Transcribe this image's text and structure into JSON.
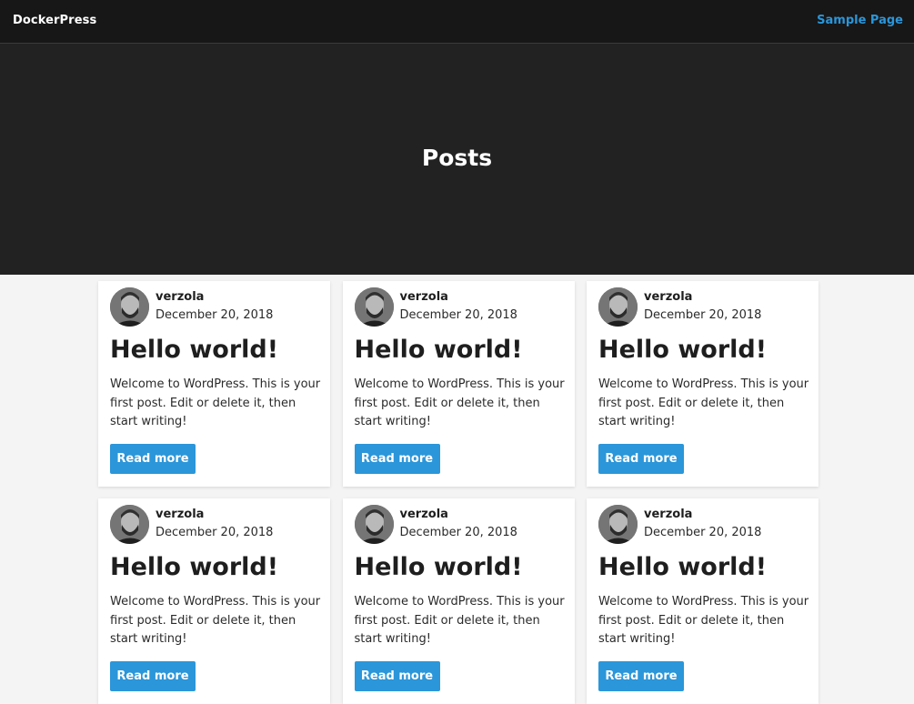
{
  "header": {
    "site_title": "DockerPress",
    "nav_link": "Sample Page"
  },
  "hero": {
    "title": "Posts"
  },
  "posts": [
    {
      "author": "verzola",
      "date": "December 20, 2018",
      "title": "Hello world!",
      "excerpt": "Welcome to WordPress. This is your first post. Edit or delete it, then start writing!",
      "button": "Read more"
    },
    {
      "author": "verzola",
      "date": "December 20, 2018",
      "title": "Hello world!",
      "excerpt": "Welcome to WordPress. This is your first post. Edit or delete it, then start writing!",
      "button": "Read more"
    },
    {
      "author": "verzola",
      "date": "December 20, 2018",
      "title": "Hello world!",
      "excerpt": "Welcome to WordPress. This is your first post. Edit or delete it, then start writing!",
      "button": "Read more"
    },
    {
      "author": "verzola",
      "date": "December 20, 2018",
      "title": "Hello world!",
      "excerpt": "Welcome to WordPress. This is your first post. Edit or delete it, then start writing!",
      "button": "Read more"
    },
    {
      "author": "verzola",
      "date": "December 20, 2018",
      "title": "Hello world!",
      "excerpt": "Welcome to WordPress. This is your first post. Edit or delete it, then start writing!",
      "button": "Read more"
    },
    {
      "author": "verzola",
      "date": "December 20, 2018",
      "title": "Hello world!",
      "excerpt": "Welcome to WordPress. This is your first post. Edit or delete it, then start writing!",
      "button": "Read more"
    }
  ],
  "colors": {
    "topbar_bg": "#171717",
    "hero_bg": "#222222",
    "accent": "#2b96d9",
    "page_bg": "#f4f4f4"
  }
}
